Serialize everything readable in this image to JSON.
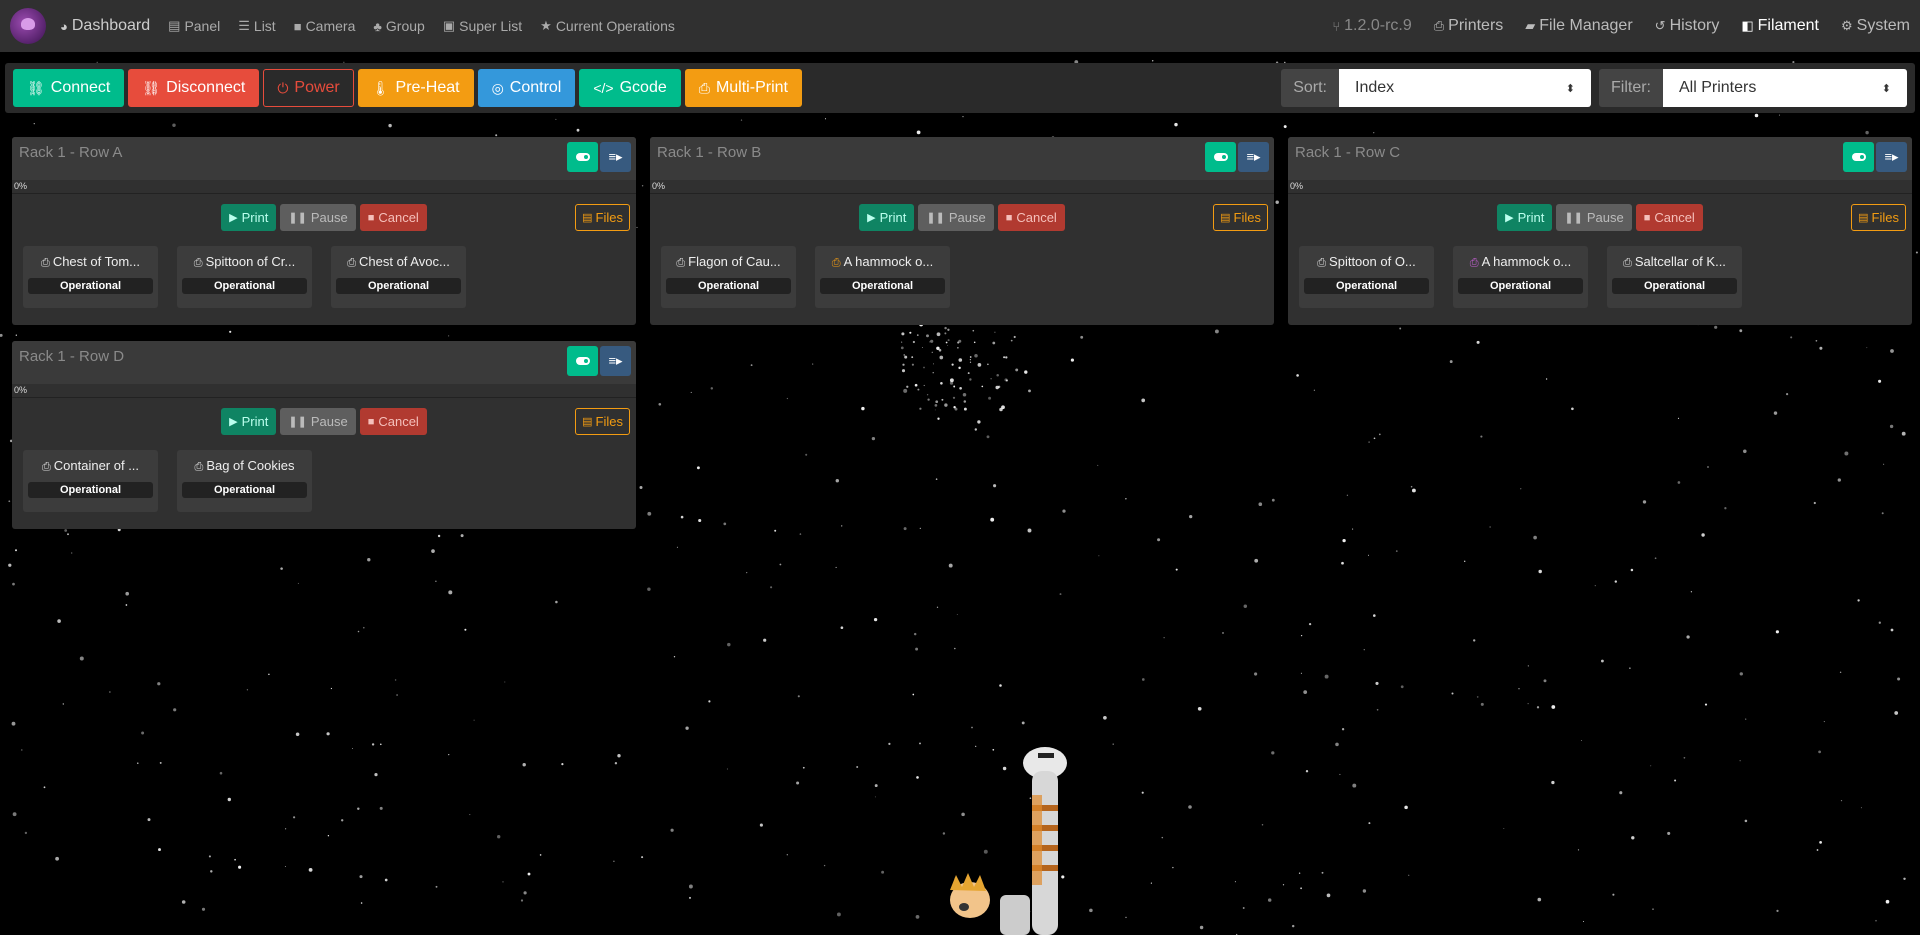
{
  "nav": {
    "left": [
      {
        "label": "Dashboard",
        "icon": "palette-icon"
      },
      {
        "label": "Panel",
        "icon": "panel-icon"
      },
      {
        "label": "List",
        "icon": "list-icon"
      },
      {
        "label": "Camera",
        "icon": "camera-icon"
      },
      {
        "label": "Group",
        "icon": "group-icon"
      },
      {
        "label": "Super List",
        "icon": "superlist-icon"
      },
      {
        "label": "Current Operations",
        "icon": "star-icon"
      }
    ],
    "right": [
      {
        "label": "1.2.0-rc.9",
        "icon": "branch-icon"
      },
      {
        "label": "Printers",
        "icon": "printer-icon"
      },
      {
        "label": "File Manager",
        "icon": "folder-icon"
      },
      {
        "label": "History",
        "icon": "history-icon"
      },
      {
        "label": "Filament",
        "icon": "filament-icon"
      },
      {
        "label": "System",
        "icon": "gears-icon"
      }
    ]
  },
  "toolbar": {
    "connect": "Connect",
    "disconnect": "Disconnect",
    "power": "Power",
    "preheat": "Pre-Heat",
    "control": "Control",
    "gcode": "Gcode",
    "multiprint": "Multi-Print",
    "sort_label": "Sort:",
    "sort_value": "Index",
    "filter_label": "Filter:",
    "filter_value": "All Printers"
  },
  "groups": [
    {
      "title": "Rack 1 - Row A",
      "progress": "0%",
      "printers": [
        {
          "name": "Chest of Tom...",
          "status": "Operational",
          "icon_color": "#dddddd"
        },
        {
          "name": "Spittoon of Cr...",
          "status": "Operational",
          "icon_color": "#dddddd"
        },
        {
          "name": "Chest of Avoc...",
          "status": "Operational",
          "icon_color": "#dddddd"
        }
      ]
    },
    {
      "title": "Rack 1 - Row B",
      "progress": "0%",
      "printers": [
        {
          "name": "Flagon of Cau...",
          "status": "Operational",
          "icon_color": "#dddddd"
        },
        {
          "name": "A hammock o...",
          "status": "Operational",
          "icon_color": "#f39c12"
        }
      ]
    },
    {
      "title": "Rack 1 - Row C",
      "progress": "0%",
      "printers": [
        {
          "name": "Spittoon of O...",
          "status": "Operational",
          "icon_color": "#dddddd"
        },
        {
          "name": "A hammock o...",
          "status": "Operational",
          "icon_color": "#c860d8"
        },
        {
          "name": "Saltcellar of K...",
          "status": "Operational",
          "icon_color": "#dddddd"
        }
      ]
    },
    {
      "title": "Rack 1 - Row D",
      "progress": "0%",
      "printers": [
        {
          "name": "Container of ...",
          "status": "Operational",
          "icon_color": "#dddddd"
        },
        {
          "name": "Bag of Cookies",
          "status": "Operational",
          "icon_color": "#dddddd"
        }
      ]
    }
  ],
  "group_actions": {
    "print": "Print",
    "pause": "Pause",
    "cancel": "Cancel",
    "files": "Files"
  },
  "colors": {
    "success": "#00bc8c",
    "danger": "#e74c3c",
    "warning": "#f39c12",
    "info": "#3498db",
    "primary": "#375a7f"
  }
}
